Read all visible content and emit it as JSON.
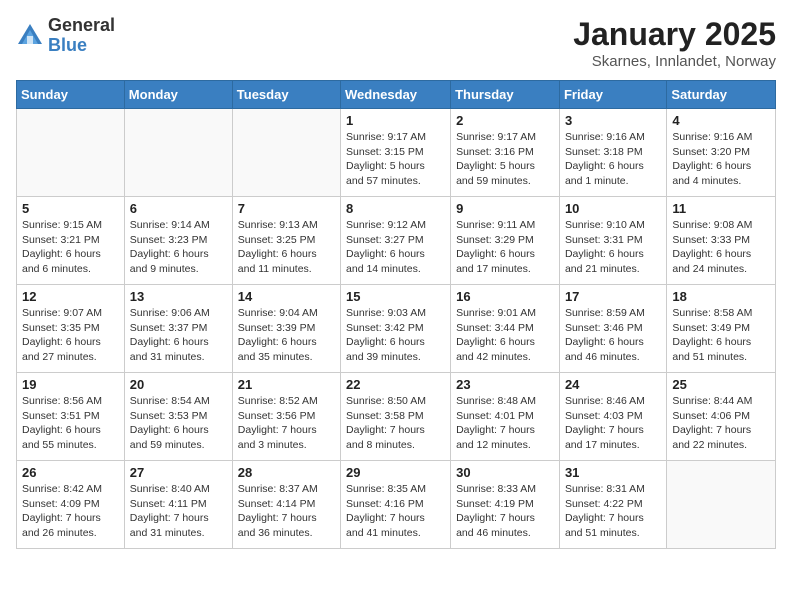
{
  "header": {
    "logo_general": "General",
    "logo_blue": "Blue",
    "month_title": "January 2025",
    "location": "Skarnes, Innlandet, Norway"
  },
  "columns": [
    "Sunday",
    "Monday",
    "Tuesday",
    "Wednesday",
    "Thursday",
    "Friday",
    "Saturday"
  ],
  "weeks": [
    [
      {
        "day": "",
        "info": ""
      },
      {
        "day": "",
        "info": ""
      },
      {
        "day": "",
        "info": ""
      },
      {
        "day": "1",
        "info": "Sunrise: 9:17 AM\nSunset: 3:15 PM\nDaylight: 5 hours and 57 minutes."
      },
      {
        "day": "2",
        "info": "Sunrise: 9:17 AM\nSunset: 3:16 PM\nDaylight: 5 hours and 59 minutes."
      },
      {
        "day": "3",
        "info": "Sunrise: 9:16 AM\nSunset: 3:18 PM\nDaylight: 6 hours and 1 minute."
      },
      {
        "day": "4",
        "info": "Sunrise: 9:16 AM\nSunset: 3:20 PM\nDaylight: 6 hours and 4 minutes."
      }
    ],
    [
      {
        "day": "5",
        "info": "Sunrise: 9:15 AM\nSunset: 3:21 PM\nDaylight: 6 hours and 6 minutes."
      },
      {
        "day": "6",
        "info": "Sunrise: 9:14 AM\nSunset: 3:23 PM\nDaylight: 6 hours and 9 minutes."
      },
      {
        "day": "7",
        "info": "Sunrise: 9:13 AM\nSunset: 3:25 PM\nDaylight: 6 hours and 11 minutes."
      },
      {
        "day": "8",
        "info": "Sunrise: 9:12 AM\nSunset: 3:27 PM\nDaylight: 6 hours and 14 minutes."
      },
      {
        "day": "9",
        "info": "Sunrise: 9:11 AM\nSunset: 3:29 PM\nDaylight: 6 hours and 17 minutes."
      },
      {
        "day": "10",
        "info": "Sunrise: 9:10 AM\nSunset: 3:31 PM\nDaylight: 6 hours and 21 minutes."
      },
      {
        "day": "11",
        "info": "Sunrise: 9:08 AM\nSunset: 3:33 PM\nDaylight: 6 hours and 24 minutes."
      }
    ],
    [
      {
        "day": "12",
        "info": "Sunrise: 9:07 AM\nSunset: 3:35 PM\nDaylight: 6 hours and 27 minutes."
      },
      {
        "day": "13",
        "info": "Sunrise: 9:06 AM\nSunset: 3:37 PM\nDaylight: 6 hours and 31 minutes."
      },
      {
        "day": "14",
        "info": "Sunrise: 9:04 AM\nSunset: 3:39 PM\nDaylight: 6 hours and 35 minutes."
      },
      {
        "day": "15",
        "info": "Sunrise: 9:03 AM\nSunset: 3:42 PM\nDaylight: 6 hours and 39 minutes."
      },
      {
        "day": "16",
        "info": "Sunrise: 9:01 AM\nSunset: 3:44 PM\nDaylight: 6 hours and 42 minutes."
      },
      {
        "day": "17",
        "info": "Sunrise: 8:59 AM\nSunset: 3:46 PM\nDaylight: 6 hours and 46 minutes."
      },
      {
        "day": "18",
        "info": "Sunrise: 8:58 AM\nSunset: 3:49 PM\nDaylight: 6 hours and 51 minutes."
      }
    ],
    [
      {
        "day": "19",
        "info": "Sunrise: 8:56 AM\nSunset: 3:51 PM\nDaylight: 6 hours and 55 minutes."
      },
      {
        "day": "20",
        "info": "Sunrise: 8:54 AM\nSunset: 3:53 PM\nDaylight: 6 hours and 59 minutes."
      },
      {
        "day": "21",
        "info": "Sunrise: 8:52 AM\nSunset: 3:56 PM\nDaylight: 7 hours and 3 minutes."
      },
      {
        "day": "22",
        "info": "Sunrise: 8:50 AM\nSunset: 3:58 PM\nDaylight: 7 hours and 8 minutes."
      },
      {
        "day": "23",
        "info": "Sunrise: 8:48 AM\nSunset: 4:01 PM\nDaylight: 7 hours and 12 minutes."
      },
      {
        "day": "24",
        "info": "Sunrise: 8:46 AM\nSunset: 4:03 PM\nDaylight: 7 hours and 17 minutes."
      },
      {
        "day": "25",
        "info": "Sunrise: 8:44 AM\nSunset: 4:06 PM\nDaylight: 7 hours and 22 minutes."
      }
    ],
    [
      {
        "day": "26",
        "info": "Sunrise: 8:42 AM\nSunset: 4:09 PM\nDaylight: 7 hours and 26 minutes."
      },
      {
        "day": "27",
        "info": "Sunrise: 8:40 AM\nSunset: 4:11 PM\nDaylight: 7 hours and 31 minutes."
      },
      {
        "day": "28",
        "info": "Sunrise: 8:37 AM\nSunset: 4:14 PM\nDaylight: 7 hours and 36 minutes."
      },
      {
        "day": "29",
        "info": "Sunrise: 8:35 AM\nSunset: 4:16 PM\nDaylight: 7 hours and 41 minutes."
      },
      {
        "day": "30",
        "info": "Sunrise: 8:33 AM\nSunset: 4:19 PM\nDaylight: 7 hours and 46 minutes."
      },
      {
        "day": "31",
        "info": "Sunrise: 8:31 AM\nSunset: 4:22 PM\nDaylight: 7 hours and 51 minutes."
      },
      {
        "day": "",
        "info": ""
      }
    ]
  ]
}
